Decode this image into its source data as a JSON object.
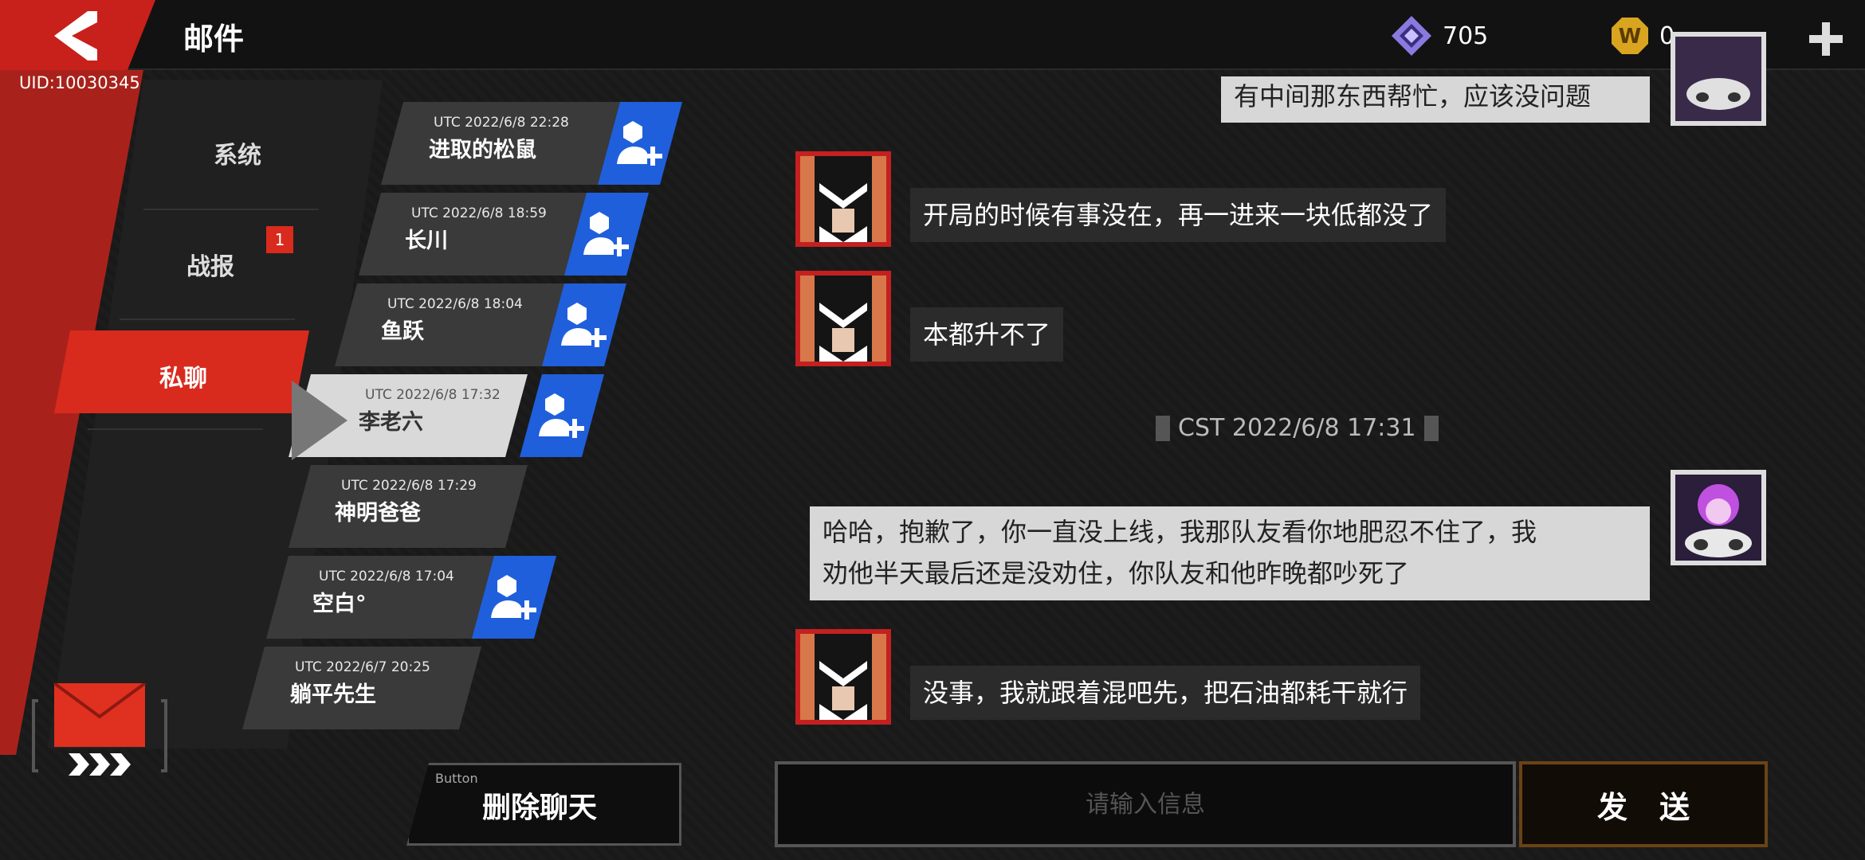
{
  "header": {
    "title": "邮件",
    "uid": "UID:10030345",
    "gems": "705",
    "coins": "0"
  },
  "categories": [
    {
      "label": "系统"
    },
    {
      "label": "战报",
      "badge": "1"
    },
    {
      "label": "私聊"
    }
  ],
  "chats": [
    {
      "time": "UTC 2022/6/8 22:28",
      "name": "进取的松鼠",
      "add": true
    },
    {
      "time": "UTC 2022/6/8 18:59",
      "name": "长川",
      "add": true
    },
    {
      "time": "UTC 2022/6/8 18:04",
      "name": "鱼跃",
      "add": true
    },
    {
      "time": "UTC 2022/6/8 17:32",
      "name": "李老六",
      "add": true,
      "selected": true
    },
    {
      "time": "UTC 2022/6/8 17:29",
      "name": "神明爸爸",
      "add": false
    },
    {
      "time": "UTC 2022/6/8 17:04",
      "name": "空白°",
      "add": true
    },
    {
      "time": "UTC 2022/6/7 20:25",
      "name": "躺平先生",
      "add": false
    }
  ],
  "delete_button": {
    "small": "Button",
    "label": "删除聊天"
  },
  "messages": [
    {
      "side": "right",
      "text": "有中间那东西帮忙，应该没问题"
    },
    {
      "side": "left",
      "text": "开局的时候有事没在，再一进来一块低都没了"
    },
    {
      "side": "left",
      "text": "本都升不了"
    },
    {
      "side": "right",
      "line1": "哈哈，抱歉了，你一直没上线，我那队友看你地肥忍不住了，我",
      "line2": "劝他半天最后还是没劝住，你队友和他昨晚都吵死了"
    },
    {
      "side": "left",
      "text": "没事，我就跟着混吧先，把石油都耗干就行"
    }
  ],
  "timestamp": "CST 2022/6/8 17:31",
  "input": {
    "placeholder": "请输入信息"
  },
  "send_label": "发送",
  "colors": {
    "accent_red": "#d92a1e",
    "add_blue": "#1f5fdc",
    "send_border": "#6a4316"
  }
}
